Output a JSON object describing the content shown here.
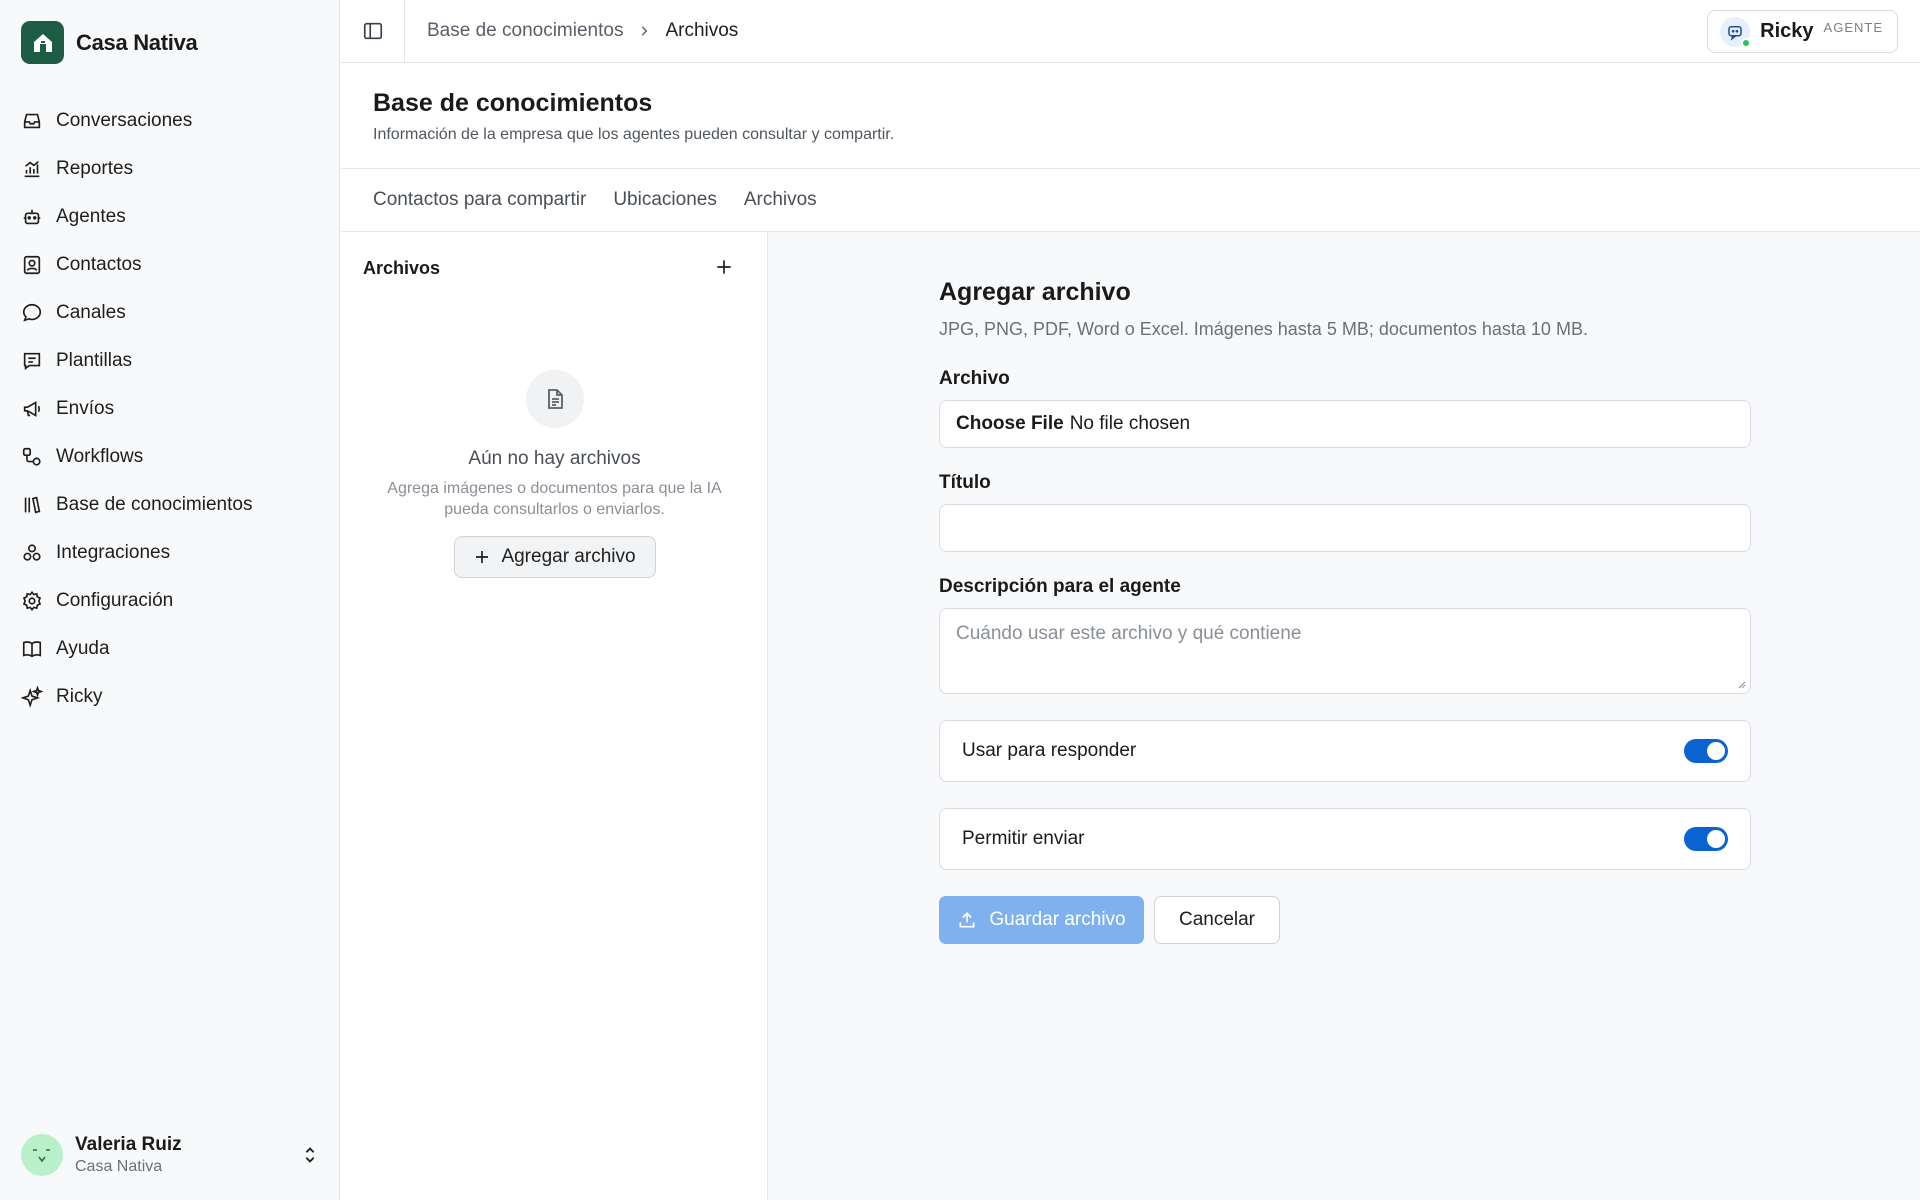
{
  "brand": {
    "name": "Casa Nativa",
    "logo_icon": "house-icon",
    "logo_color": "#1f5c45"
  },
  "sidebar": {
    "items": [
      {
        "label": "Conversaciones",
        "icon": "inbox-icon"
      },
      {
        "label": "Reportes",
        "icon": "chart-icon"
      },
      {
        "label": "Agentes",
        "icon": "robot-icon"
      },
      {
        "label": "Contactos",
        "icon": "contact-icon"
      },
      {
        "label": "Canales",
        "icon": "chat-bubble-icon"
      },
      {
        "label": "Plantillas",
        "icon": "template-icon"
      },
      {
        "label": "Envíos",
        "icon": "megaphone-icon"
      },
      {
        "label": "Workflows",
        "icon": "workflow-icon"
      },
      {
        "label": "Base de conocimientos",
        "icon": "library-icon"
      },
      {
        "label": "Integraciones",
        "icon": "integrations-icon"
      },
      {
        "label": "Configuración",
        "icon": "gear-icon"
      },
      {
        "label": "Ayuda",
        "icon": "book-icon"
      },
      {
        "label": "Ricky",
        "icon": "sparkles-icon"
      }
    ]
  },
  "user": {
    "name": "Valeria Ruiz",
    "org": "Casa Nativa"
  },
  "topbar": {
    "breadcrumb": [
      "Base de conocimientos",
      "Archivos"
    ],
    "agent_name": "Ricky",
    "agent_role": "AGENTE",
    "status_color": "#22c55e"
  },
  "page": {
    "title": "Base de conocimientos",
    "subtitle": "Información de la empresa que los agentes pueden consultar y compartir."
  },
  "tabs": [
    "Contactos para compartir",
    "Ubicaciones",
    "Archivos"
  ],
  "files_panel": {
    "heading": "Archivos",
    "empty_title": "Aún no hay archivos",
    "empty_desc": "Agrega imágenes o documentos para que la IA pueda consultarlos o enviarlos.",
    "add_button": "Agregar archivo"
  },
  "form": {
    "title": "Agregar archivo",
    "help": "JPG, PNG, PDF, Word o Excel. Imágenes hasta 5 MB; documentos hasta 10 MB.",
    "file_label": "Archivo",
    "file_button": "Choose File",
    "file_status": "No file chosen",
    "title_label": "Título",
    "title_value": "",
    "desc_label": "Descripción para el agente",
    "desc_placeholder": "Cuándo usar este archivo y qué contiene",
    "toggle_respond": "Usar para responder",
    "toggle_respond_on": true,
    "toggle_send": "Permitir enviar",
    "toggle_send_on": true,
    "save_button": "Guardar archivo",
    "cancel_button": "Cancelar",
    "accent_color": "#0b63d1"
  }
}
